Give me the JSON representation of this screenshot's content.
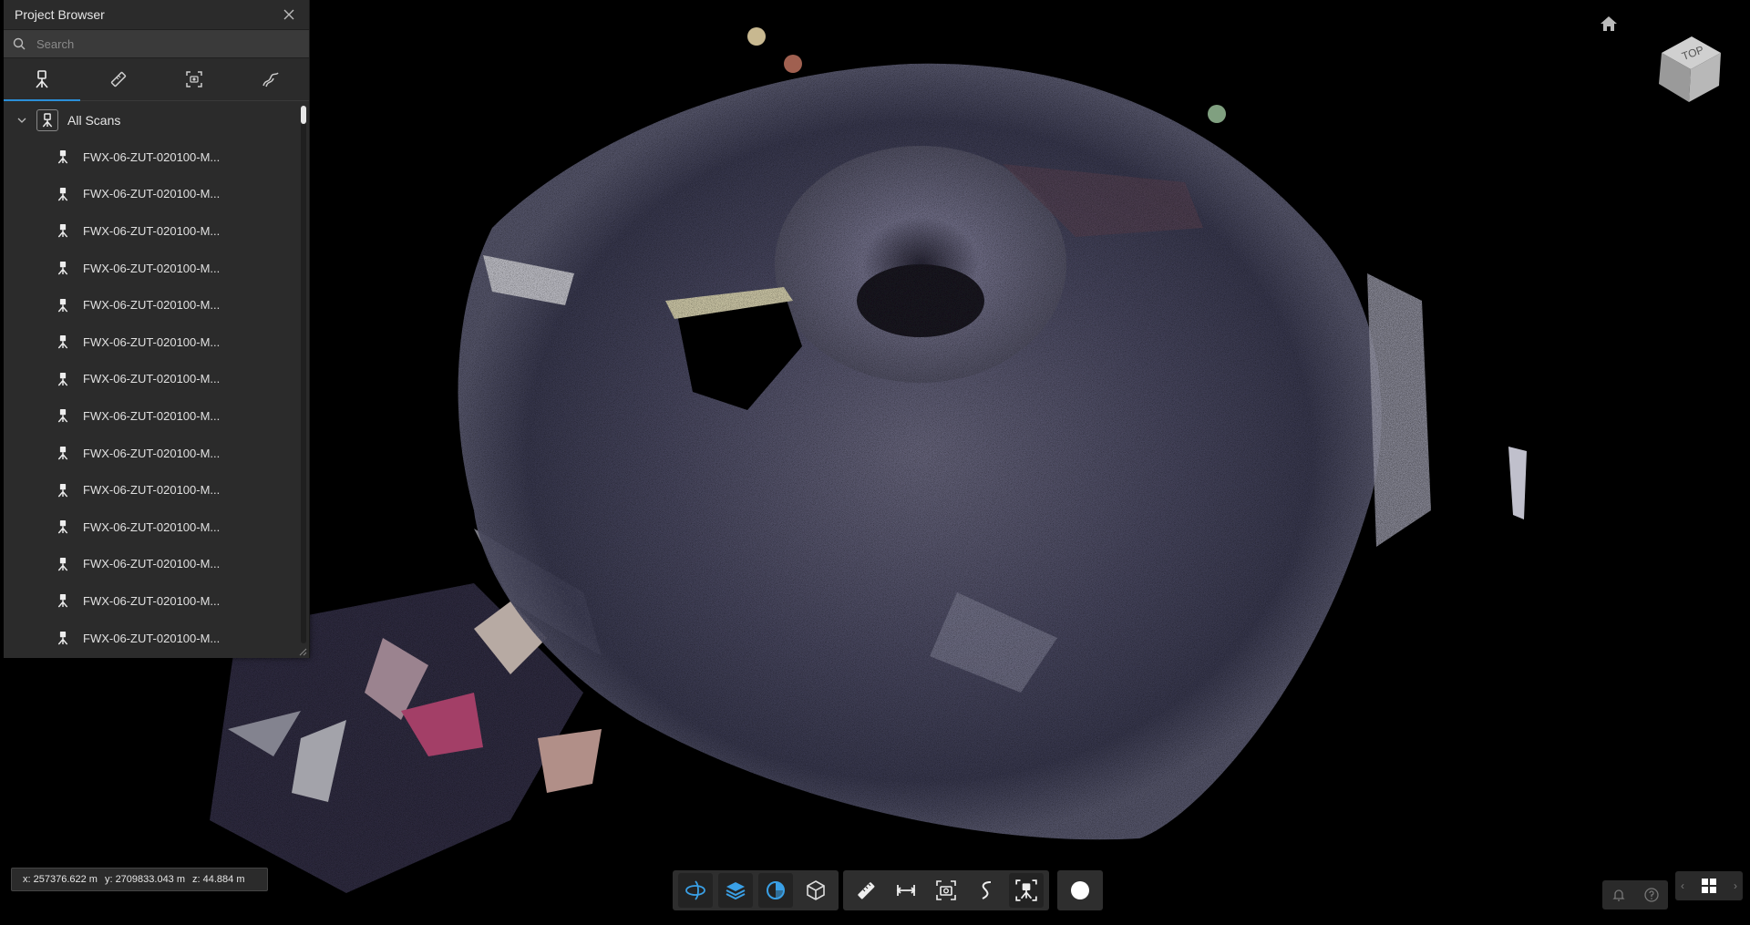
{
  "browser": {
    "title": "Project Browser",
    "search_placeholder": "Search",
    "tabs": [
      {
        "name": "scans-tab",
        "icon": "scanner-tripod-icon",
        "active": true
      },
      {
        "name": "measurements-tab",
        "icon": "ruler-icon",
        "active": false
      },
      {
        "name": "snapshots-tab",
        "icon": "focus-camera-icon",
        "active": false
      },
      {
        "name": "paths-tab",
        "icon": "path-icon",
        "active": false
      }
    ],
    "root_label": "All Scans",
    "scans": [
      "FWX-06-ZUT-020100-M...",
      "FWX-06-ZUT-020100-M...",
      "FWX-06-ZUT-020100-M...",
      "FWX-06-ZUT-020100-M...",
      "FWX-06-ZUT-020100-M...",
      "FWX-06-ZUT-020100-M...",
      "FWX-06-ZUT-020100-M...",
      "FWX-06-ZUT-020100-M...",
      "FWX-06-ZUT-020100-M...",
      "FWX-06-ZUT-020100-M...",
      "FWX-06-ZUT-020100-M...",
      "FWX-06-ZUT-020100-M...",
      "FWX-06-ZUT-020100-M...",
      "FWX-06-ZUT-020100-M..."
    ]
  },
  "coords": {
    "x": "x: 257376.622 m",
    "y": "y: 2709833.043 m",
    "z": "z: 44.884 m"
  },
  "toolbar": {
    "view_tools": [
      "orbit-icon",
      "layers-icon",
      "clipping-icon",
      "box-icon"
    ],
    "measure_tools": [
      "ruler-icon",
      "distance-icon",
      "snapshot-icon",
      "path-icon",
      "scan-icon"
    ],
    "extra_tools": [
      "circle-icon"
    ]
  },
  "navcube": {
    "face_label": "TOP"
  },
  "colors": {
    "accent": "#2b8fd8",
    "panel": "#2b2b2b",
    "background": "#000000"
  }
}
